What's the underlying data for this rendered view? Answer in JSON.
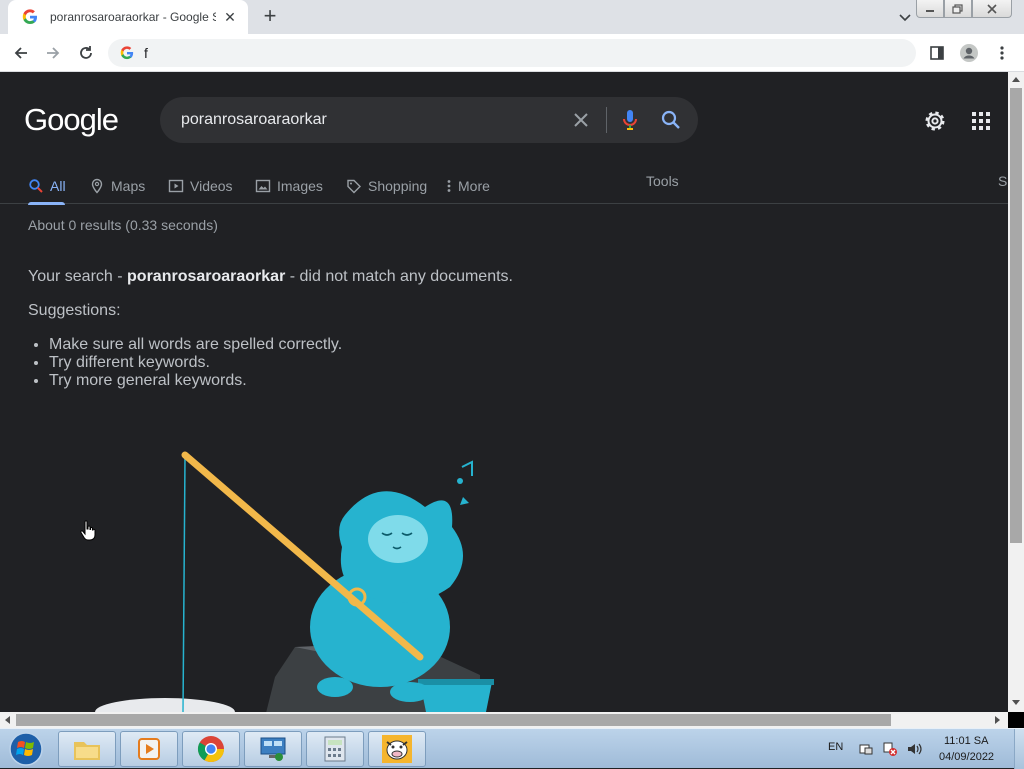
{
  "browser": {
    "tab_title": "poranrosaroaraorkar - Google Se",
    "address_text": "f"
  },
  "search": {
    "query": "poranrosaroaraorkar",
    "tabs": [
      {
        "label": "All",
        "icon": "search-icon"
      },
      {
        "label": "Maps",
        "icon": "map-pin-icon"
      },
      {
        "label": "Videos",
        "icon": "play-icon"
      },
      {
        "label": "Images",
        "icon": "image-icon"
      },
      {
        "label": "Shopping",
        "icon": "tag-icon"
      },
      {
        "label": "More",
        "icon": "more-vert-icon"
      }
    ],
    "tools_label": "Tools",
    "right_tab_label": "S"
  },
  "results": {
    "stats": "About 0 results (0.33 seconds)",
    "nomatch_prefix": "Your search - ",
    "nomatch_query": "poranrosaroaraorkar",
    "nomatch_suffix": " - did not match any documents.",
    "suggestions_heading": "Suggestions:",
    "suggestions": [
      "Make sure all words are spelled correctly.",
      "Try different keywords.",
      "Try more general keywords."
    ]
  },
  "logo_text": "Google",
  "taskbar": {
    "language": "EN",
    "time": "11:01 SA",
    "date": "04/09/2022",
    "apps": [
      "file-explorer-icon",
      "media-player-icon",
      "chrome-icon",
      "remote-desktop-icon",
      "calculator-icon",
      "cow-app-icon"
    ]
  },
  "colors": {
    "page_bg": "#202124",
    "accent": "#8ab4f8",
    "text_secondary": "#9aa0a6",
    "illustration": "#26b3cf"
  }
}
